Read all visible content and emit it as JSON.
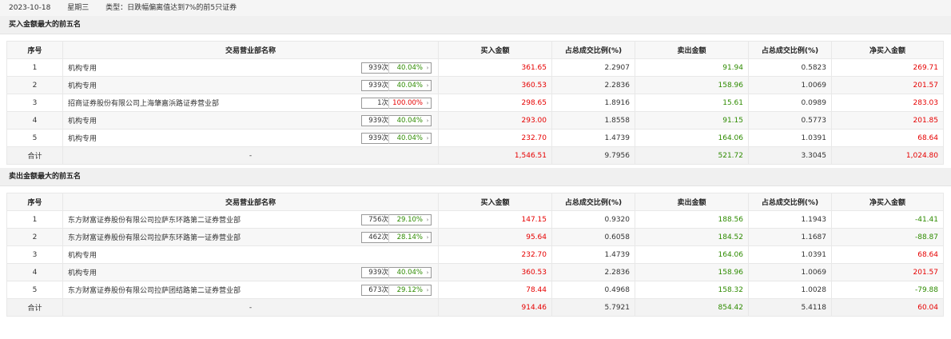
{
  "header": {
    "date": "2023-10-18",
    "weekday": "星期三",
    "type": "类型：日跌幅偏离值达到7%的前5只证券"
  },
  "columns": [
    "序号",
    "交易营业部名称",
    "买入金额",
    "占总成交比例(%)",
    "卖出金额",
    "占总成交比例(%)",
    "净买入金额"
  ],
  "buy_section": {
    "title": "买入金额最大的前五名",
    "rows": [
      {
        "idx": "1",
        "name": "机构专用",
        "times": "939次",
        "pct": "40.04%",
        "buy": "361.65",
        "buy_ratio": "2.2907",
        "sell": "91.94",
        "sell_ratio": "0.5823",
        "net": "269.71"
      },
      {
        "idx": "2",
        "name": "机构专用",
        "times": "939次",
        "pct": "40.04%",
        "buy": "360.53",
        "buy_ratio": "2.2836",
        "sell": "158.96",
        "sell_ratio": "1.0069",
        "net": "201.57"
      },
      {
        "idx": "3",
        "name": "招商证券股份有限公司上海肇嘉浜路证券营业部",
        "times": "1次",
        "pct": "100.00%",
        "buy": "298.65",
        "buy_ratio": "1.8916",
        "sell": "15.61",
        "sell_ratio": "0.0989",
        "net": "283.03"
      },
      {
        "idx": "4",
        "name": "机构专用",
        "times": "939次",
        "pct": "40.04%",
        "buy": "293.00",
        "buy_ratio": "1.8558",
        "sell": "91.15",
        "sell_ratio": "0.5773",
        "net": "201.85"
      },
      {
        "idx": "5",
        "name": "机构专用",
        "times": "939次",
        "pct": "40.04%",
        "buy": "232.70",
        "buy_ratio": "1.4739",
        "sell": "164.06",
        "sell_ratio": "1.0391",
        "net": "68.64"
      }
    ],
    "total": {
      "label": "合计",
      "name": "-",
      "buy": "1,546.51",
      "buy_ratio": "9.7956",
      "sell": "521.72",
      "sell_ratio": "3.3045",
      "net": "1,024.80"
    }
  },
  "sell_section": {
    "title": "卖出金额最大的前五名",
    "rows": [
      {
        "idx": "1",
        "name": "东方财富证券股份有限公司拉萨东环路第二证券营业部",
        "times": "756次",
        "pct": "29.10%",
        "buy": "147.15",
        "buy_ratio": "0.9320",
        "sell": "188.56",
        "sell_ratio": "1.1943",
        "net": "-41.41"
      },
      {
        "idx": "2",
        "name": "东方财富证券股份有限公司拉萨东环路第一证券营业部",
        "times": "462次",
        "pct": "28.14%",
        "buy": "95.64",
        "buy_ratio": "0.6058",
        "sell": "184.52",
        "sell_ratio": "1.1687",
        "net": "-88.87"
      },
      {
        "idx": "3",
        "name": "机构专用",
        "times": "",
        "pct": "",
        "buy": "232.70",
        "buy_ratio": "1.4739",
        "sell": "164.06",
        "sell_ratio": "1.0391",
        "net": "68.64"
      },
      {
        "idx": "4",
        "name": "机构专用",
        "times": "939次",
        "pct": "40.04%",
        "buy": "360.53",
        "buy_ratio": "2.2836",
        "sell": "158.96",
        "sell_ratio": "1.0069",
        "net": "201.57"
      },
      {
        "idx": "5",
        "name": "东方财富证券股份有限公司拉萨团结路第二证券营业部",
        "times": "673次",
        "pct": "29.12%",
        "buy": "78.44",
        "buy_ratio": "0.4968",
        "sell": "158.32",
        "sell_ratio": "1.0028",
        "net": "-79.88"
      }
    ],
    "total": {
      "label": "合计",
      "name": "-",
      "buy": "914.46",
      "buy_ratio": "5.7921",
      "sell": "854.42",
      "sell_ratio": "5.4118",
      "net": "60.04"
    }
  },
  "colors": {
    "up": "#e60000",
    "down": "#2e8b00"
  }
}
